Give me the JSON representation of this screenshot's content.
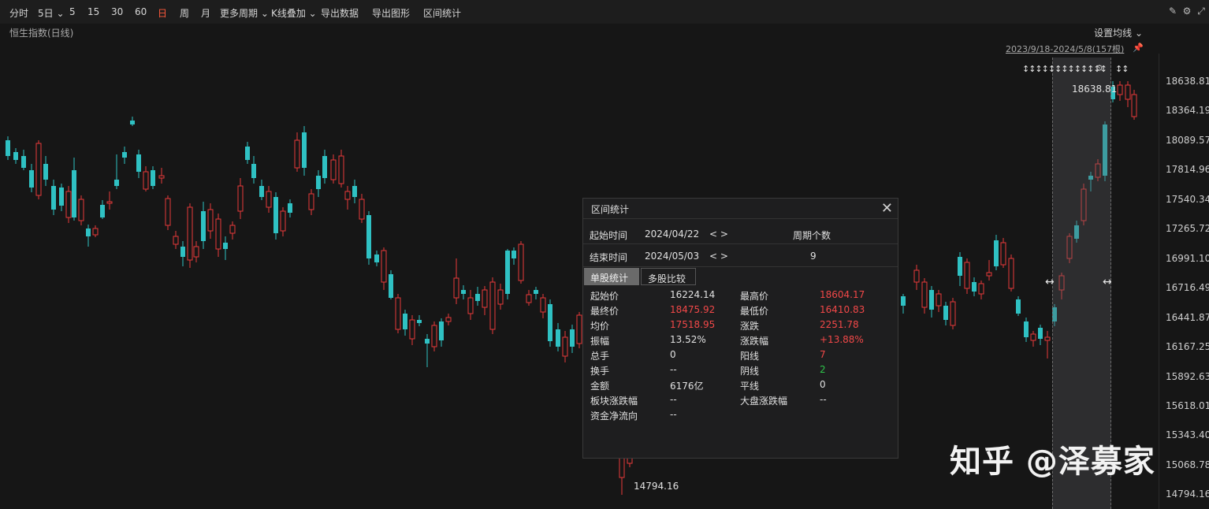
{
  "toolbar": {
    "items": [
      "分时",
      "5日 ⌄",
      "5",
      "15",
      "30",
      "60",
      "日",
      "周",
      "月",
      "更多周期 ⌄",
      "K线叠加 ⌄",
      "导出数据",
      "导出图形",
      "区间统计"
    ],
    "active_index": 6
  },
  "chart": {
    "title": "恒生指数(日线)",
    "ma_settings": "设置均线 ⌄",
    "range_label": "2023/9/18-2024/5/8(157根)",
    "high_label": "18638.81",
    "low_label": "14794.16",
    "price_ticks": [
      "18638.81",
      "18364.19",
      "18089.57",
      "17814.96",
      "17540.34",
      "17265.72",
      "16991.10",
      "16716.49",
      "16441.87",
      "16167.25",
      "15892.63",
      "15618.01",
      "15343.40",
      "15068.78",
      "14794.16"
    ],
    "up_color": "#e8393a",
    "down_color": "#2fc1c3"
  },
  "watermark": "知乎 @泽募家",
  "dialog": {
    "title": "区间统计",
    "start_label": "起始时间",
    "start_date": "2024/04/22",
    "end_label": "结束时间",
    "end_date": "2024/05/03",
    "nav": "< >",
    "period_count_label": "周期个数",
    "period_count": "9",
    "tabs": [
      "单股统计",
      "多股比较"
    ],
    "stats_left": [
      {
        "label": "起始价",
        "value": "16224.14",
        "color": "normal"
      },
      {
        "label": "最终价",
        "value": "18475.92",
        "color": "red"
      },
      {
        "label": "均价",
        "value": "17518.95",
        "color": "red"
      },
      {
        "label": "振幅",
        "value": "13.52%",
        "color": "normal"
      },
      {
        "label": "总手",
        "value": "0",
        "color": "normal"
      },
      {
        "label": "换手",
        "value": "--",
        "color": "normal"
      },
      {
        "label": "金额",
        "value": "6176亿",
        "color": "normal"
      },
      {
        "label": "板块涨跌幅",
        "value": "--",
        "color": "normal"
      },
      {
        "label": "资金净流向",
        "value": "--",
        "color": "normal"
      }
    ],
    "stats_right": [
      {
        "label": "最高价",
        "value": "18604.17",
        "color": "red"
      },
      {
        "label": "最低价",
        "value": "16410.83",
        "color": "red"
      },
      {
        "label": "涨跌",
        "value": "2251.78",
        "color": "red"
      },
      {
        "label": "涨跌幅",
        "value": "+13.88%",
        "color": "red"
      },
      {
        "label": "阳线",
        "value": "7",
        "color": "red"
      },
      {
        "label": "阴线",
        "value": "2",
        "color": "green"
      },
      {
        "label": "平线",
        "value": "0",
        "color": "normal"
      },
      {
        "label": "大盘涨跌幅",
        "value": "--",
        "color": "normal"
      }
    ]
  }
}
